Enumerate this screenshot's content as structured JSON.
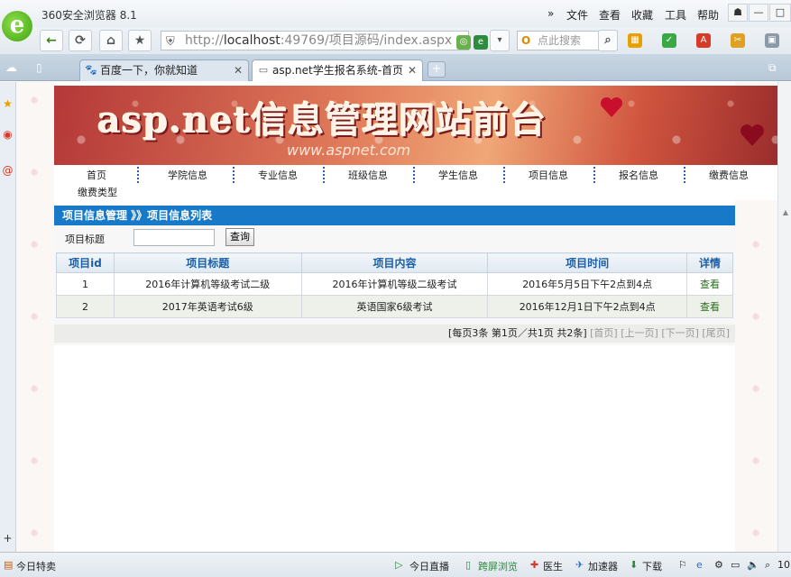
{
  "browser": {
    "app_title": "360安全浏览器 8.1",
    "menu": [
      "文件",
      "查看",
      "收藏",
      "工具",
      "帮助"
    ],
    "url_prefix": "http://",
    "url_host": "localhost",
    "url_rest": ":49769/项目源码/index.aspx",
    "search_placeholder": "点此搜索",
    "tabs": [
      {
        "label": "百度一下，你就知道",
        "active": false
      },
      {
        "label": "asp.net学生报名系统-首页",
        "active": true
      }
    ],
    "status": {
      "left": "今日特卖",
      "items": [
        "今日直播",
        "跨屏浏览",
        "医生",
        "加速器",
        "下载"
      ],
      "zoom": "10"
    }
  },
  "page": {
    "banner_title": "asp.net信息管理网站前台",
    "banner_url": "www.aspnet.com",
    "nav": [
      "首页",
      "学院信息",
      "专业信息",
      "班级信息",
      "学生信息",
      "项目信息",
      "报名信息",
      "缴费信息",
      "缴费类型"
    ],
    "panel_title": "项目信息管理 》》项目信息列表",
    "search_label": "项目标题",
    "search_value": "",
    "search_button": "查询",
    "table": {
      "headers": [
        "项目id",
        "项目标题",
        "项目内容",
        "项目时间",
        "详情"
      ],
      "rows": [
        [
          "1",
          "2016年计算机等级考试二级",
          "2016年计算机等级二级考试",
          "2016年5月5日下午2点到4点",
          "查看"
        ],
        [
          "2",
          "2017年英语考试6级",
          "英语国家6级考试",
          "2016年12月1日下午2点到4点",
          "查看"
        ]
      ]
    },
    "pager": {
      "info": "[每页3条 第1页／共1页 共2条]",
      "first": "[首页]",
      "prev": "[上一页]",
      "next": "[下一页]",
      "last": "[尾页]"
    }
  }
}
